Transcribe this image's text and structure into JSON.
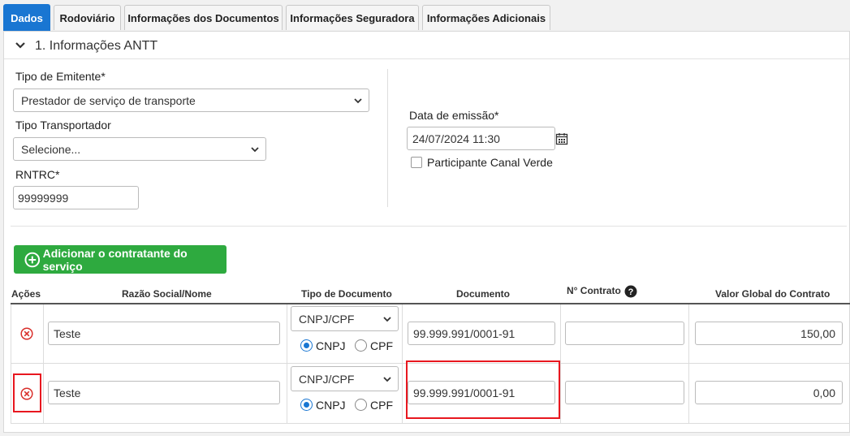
{
  "tabs": [
    {
      "label": "Dados",
      "active": true
    },
    {
      "label": "Rodoviário",
      "active": false
    },
    {
      "label": "Informações dos Documentos",
      "active": false
    },
    {
      "label": "Informações Seguradora",
      "active": false
    },
    {
      "label": "Informações Adicionais",
      "active": false
    }
  ],
  "section": {
    "title": "1. Informações ANTT",
    "icon": "chevron-down-icon"
  },
  "form": {
    "tipo_emitente_label": "Tipo de Emitente*",
    "tipo_emitente_value": "Prestador de serviço de transporte",
    "tipo_transportador_label": "Tipo Transportador",
    "tipo_transportador_value": "Selecione...",
    "rntrc_label": "RNTRC*",
    "rntrc_value": "99999999",
    "data_emissao_label": "Data de emissão*",
    "data_emissao_value": "24/07/2024 11:30",
    "canal_verde_label": "Participante Canal Verde"
  },
  "add_button": {
    "label": "Adicionar o contratante do serviço",
    "color": "#2eaa3f"
  },
  "table": {
    "headers": {
      "acoes": "Ações",
      "razao": "Razão Social/Nome",
      "tipo_doc": "Tipo de Documento",
      "documento": "Documento",
      "contrato": "N° Contrato",
      "valor": "Valor Global do Contrato"
    },
    "rows": [
      {
        "razao": "Teste",
        "tipo_doc": "CNPJ/CPF",
        "radio_cnpj": "CNPJ",
        "radio_cpf": "CPF",
        "documento": "99.999.991/0001-91",
        "contrato": "",
        "valor": "150,00"
      },
      {
        "razao": "Teste",
        "tipo_doc": "CNPJ/CPF",
        "radio_cnpj": "CNPJ",
        "radio_cpf": "CPF",
        "documento": "99.999.991/0001-91",
        "contrato": "",
        "valor": "0,00"
      }
    ]
  },
  "colors": {
    "accent": "#1976d2",
    "success": "#2eaa3f",
    "danger": "#e8171f"
  }
}
